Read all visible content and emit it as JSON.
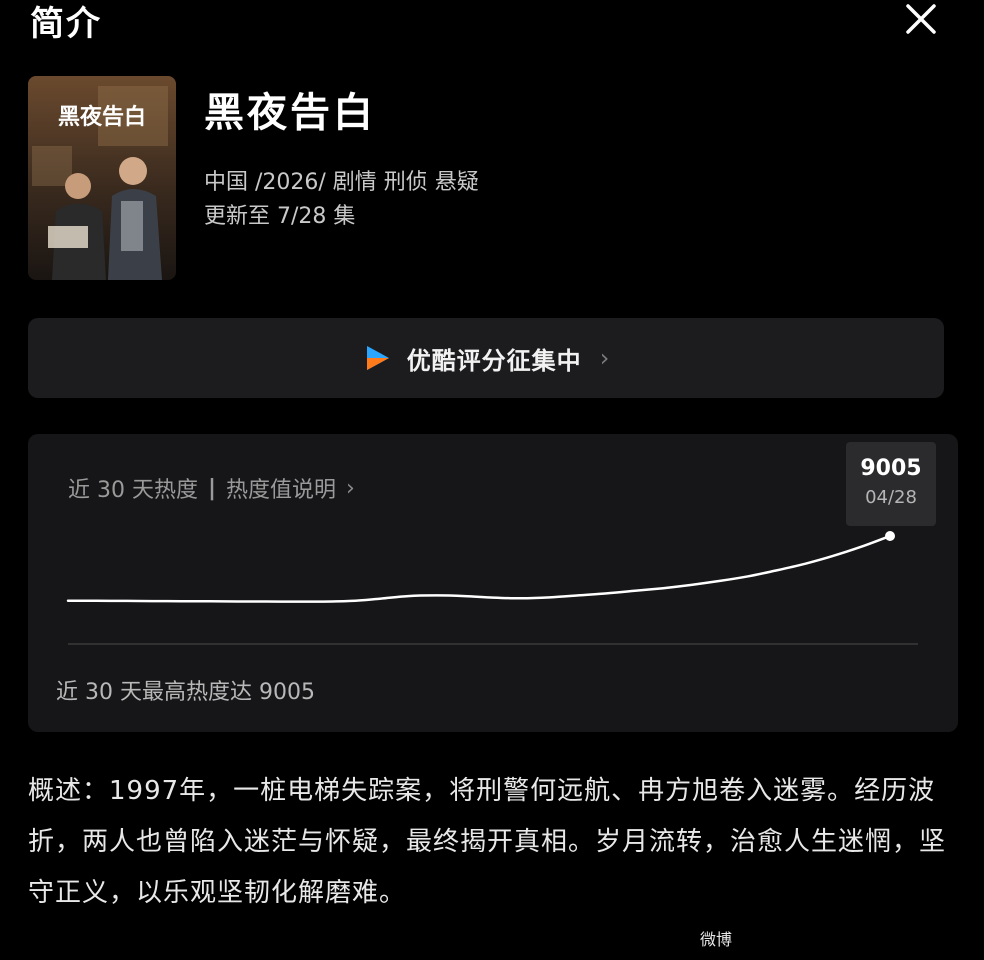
{
  "header": {
    "title": "简介"
  },
  "show": {
    "poster_title": "黑夜告白",
    "name": "黑夜告白",
    "meta_line": "中国 /2026/ 剧情  刑侦  悬疑",
    "update_line": "更新至 7/28 集"
  },
  "rating": {
    "label": "优酷评分征集中",
    "chevron": "›"
  },
  "heat": {
    "range_label": "近 30 天热度",
    "separator": "|",
    "explain_label": "热度值说明",
    "chevron": "›",
    "tooltip_value": "9005",
    "tooltip_date": "04/28",
    "summary": "近 30 天最高热度达 9005"
  },
  "chart_data": {
    "type": "line",
    "series": [
      {
        "values": [
          4100,
          4090,
          4080,
          4070,
          4060,
          4050,
          4040,
          4035,
          4030,
          4030,
          4080,
          4250,
          4450,
          4500,
          4450,
          4330,
          4280,
          4350,
          4500,
          4650,
          4850,
          5050,
          5300,
          5600,
          5950,
          6400,
          6900,
          7500,
          8200,
          9005
        ]
      }
    ],
    "peak": 9005,
    "peak_date": "04/28"
  },
  "overview": {
    "text": "概述：1997年，一桩电梯失踪案，将刑警何远航、冉方旭卷入迷雾。经历波折，两人也曾陷入迷茫与怀疑，最终揭开真相。岁月流转，治愈人生迷惘，坚守正义，以乐观坚韧化解磨难。"
  },
  "watermark": "微博",
  "colors": {
    "background": "#000000",
    "card": "#1c1c1e",
    "line": "#ffffff",
    "youku_blue": "#2aa6ff",
    "youku_orange": "#ff7a1a"
  },
  "icons": {
    "close": "close-icon",
    "rating_logo": "youku-logo-icon"
  }
}
